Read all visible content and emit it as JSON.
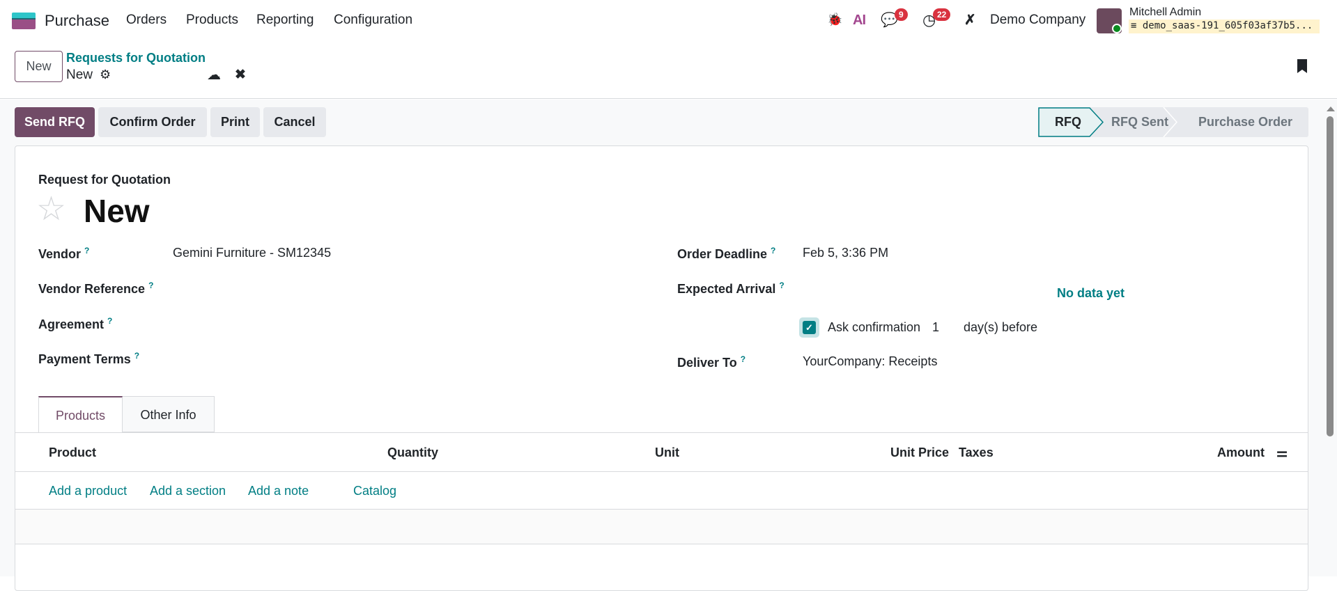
{
  "navbar": {
    "app_name": "Purchase",
    "menu": [
      "Orders",
      "Products",
      "Reporting",
      "Configuration"
    ],
    "messages_count": "9",
    "activities_count": "22",
    "ai_label": "AI",
    "company": "Demo Company",
    "user_name": "Mitchell Admin",
    "database": "demo_saas-191_605f03af37b5..."
  },
  "control_panel": {
    "new_label": "New",
    "breadcrumb_parent": "Requests for Quotation",
    "breadcrumb_current": "New"
  },
  "actions": {
    "send_rfq": "Send RFQ",
    "confirm_order": "Confirm Order",
    "print": "Print",
    "cancel": "Cancel"
  },
  "statusbar": {
    "stages": [
      "RFQ",
      "RFQ Sent",
      "Purchase Order"
    ],
    "active": "RFQ"
  },
  "form": {
    "subtitle": "Request for Quotation",
    "title": "New",
    "help": "?",
    "left": [
      {
        "label": "Vendor",
        "value": "Gemini Furniture - SM12345"
      },
      {
        "label": "Vendor Reference",
        "value": ""
      },
      {
        "label": "Agreement",
        "value": ""
      },
      {
        "label": "Payment Terms",
        "value": ""
      }
    ],
    "right": {
      "order_deadline_label": "Order Deadline",
      "order_deadline": "Feb 5, 3:36 PM",
      "expected_arrival_label": "Expected Arrival",
      "no_data": "No data yet",
      "ask_confirmation_label": "Ask confirmation",
      "ask_confirmation_checked": true,
      "days": "1",
      "days_suffix": "day(s) before",
      "deliver_to_label": "Deliver To",
      "deliver_to": "YourCompany: Receipts"
    }
  },
  "tabs": [
    "Products",
    "Other Info"
  ],
  "table": {
    "columns": [
      "Product",
      "Quantity",
      "Unit",
      "Unit Price",
      "Taxes",
      "Amount"
    ],
    "add_links": [
      "Add a product",
      "Add a section",
      "Add a note",
      "Catalog"
    ]
  },
  "colors": {
    "primary": "#714b67",
    "link": "#017e84"
  }
}
